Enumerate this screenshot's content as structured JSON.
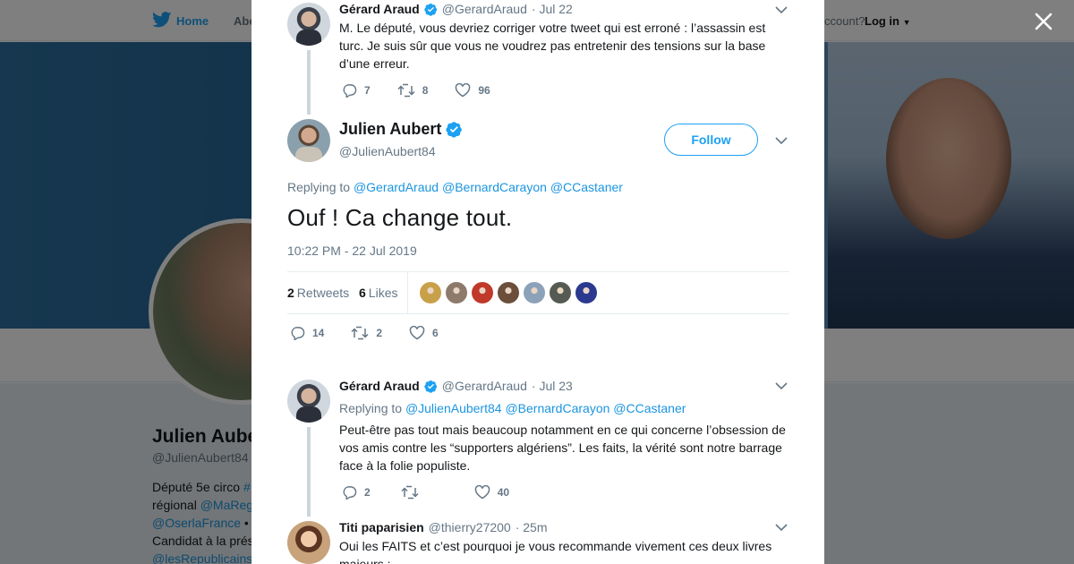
{
  "nav": {
    "home_label": "Home",
    "about_label": "Abo",
    "account_text": "ccount?",
    "login_label": "Log in"
  },
  "profile": {
    "name": "Julien Aube",
    "handle": "@JulienAubert84",
    "bio": [
      [
        {
          "t": "Député 5e circo "
        },
        {
          "t": "#",
          "link": true
        }
      ],
      [
        {
          "t": "régional "
        },
        {
          "t": "@MaReg",
          "link": true
        }
      ],
      [
        {
          "t": "@OserlaFrance",
          "link": true
        },
        {
          "t": " •"
        }
      ],
      [
        {
          "t": "Candidat à la prés"
        }
      ],
      [
        {
          "t": "@lesRepublicains",
          "link": true
        }
      ]
    ]
  },
  "tweets": {
    "parent": {
      "name": "Gérard Araud",
      "handle": "@GerardAraud",
      "time": "· Jul 22",
      "text": "M. Le député, vous devriez corriger votre tweet qui est erroné : l’assassin est turc. Je suis sûr que vous ne voudrez pas entretenir des tensions sur la base d’une erreur.",
      "replies": "7",
      "retweets": "8",
      "likes": "96"
    },
    "main": {
      "name": "Julien Aubert",
      "handle": "@JulienAubert84",
      "follow_label": "Follow",
      "replying_label": "Replying to",
      "replying_to": [
        "@GerardAraud",
        "@BernardCarayon",
        "@CCastaner"
      ],
      "text": "Ouf ! Ca change tout.",
      "timestamp": "10:22 PM - 22 Jul 2019",
      "retweets_count": "2",
      "retweets_label": "Retweets",
      "likes_count": "6",
      "likes_label": "Likes",
      "liker_colors": [
        "#c9a04a",
        "#8d7a6a",
        "#c0392b",
        "#6b4f3a",
        "#8ca2b8",
        "#555b52",
        "#2b3a8f"
      ],
      "replies": "14",
      "retweets": "2",
      "likes": "6"
    },
    "reply1": {
      "name": "Gérard Araud",
      "handle": "@GerardAraud",
      "time": "· Jul 23",
      "replying_label": "Replying to",
      "replying_to": [
        "@JulienAubert84",
        "@BernardCarayon",
        "@CCastaner"
      ],
      "text": "Peut-être pas tout mais beaucoup notamment en ce qui concerne l’obsession de vos amis contre les “supporters algériens”. Les faits, la vérité sont notre barrage face à la folie populiste.",
      "replies": "2",
      "retweets": "",
      "likes": "40"
    },
    "reply2": {
      "name": "Titi paparisien",
      "handle": "@thierry27200",
      "time": "· 25m",
      "text": "Oui les FAITS et c’est pourquoi je vous recommande vivement ces deux livres majeurs :"
    }
  },
  "colors": {
    "accent": "#1da1f2",
    "link": "#1b95e0",
    "muted": "#657786",
    "text": "#14171a"
  }
}
